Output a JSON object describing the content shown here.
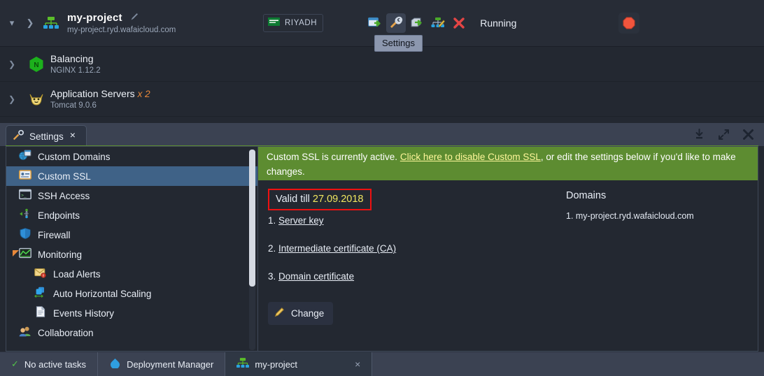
{
  "env_header": {
    "collapse_icon": "chevron-down",
    "expand_icon": "chevron-right",
    "env_icon": "environment-topology-icon",
    "name": "my-project",
    "edit_icon": "pencil-icon",
    "domain": "my-project.ryd.wafaicloud.com",
    "region": {
      "label": "RIYADH",
      "flag_icon": "saudi-flag-icon"
    },
    "tools": [
      {
        "name": "open-in-browser-icon",
        "title": "Open in Browser",
        "active": false
      },
      {
        "name": "settings-icon",
        "title": "Settings",
        "active": true
      },
      {
        "name": "clone-environment-icon",
        "title": "Clone Environment",
        "active": false
      },
      {
        "name": "change-topology-icon",
        "title": "Change Environment Topology",
        "active": false
      },
      {
        "name": "delete-icon",
        "title": "Delete Environment",
        "active": false
      }
    ],
    "status": "Running",
    "stop_icon": "stop-octagon-icon",
    "tooltip": "Settings"
  },
  "nodes": [
    {
      "chevron": "chevron-right",
      "icon": "nginx-icon",
      "title": "Balancing",
      "count": "",
      "subtitle": "NGINX 1.12.2"
    },
    {
      "chevron": "chevron-right",
      "icon": "tomcat-icon",
      "title": "Application Servers",
      "count": "x 2",
      "subtitle": "Tomcat 9.0.6"
    }
  ],
  "window": {
    "tab": {
      "icon": "settings-icon",
      "label": "Settings",
      "close": "×"
    },
    "actions": [
      {
        "name": "download-icon",
        "title": "Download"
      },
      {
        "name": "maximize-icon",
        "title": "Maximize"
      },
      {
        "name": "close-icon",
        "title": "Close"
      }
    ]
  },
  "sidebar": {
    "items": [
      {
        "label": "Custom Domains",
        "icon": "custom-domains-icon",
        "selected": false,
        "sub": false,
        "toggle": ""
      },
      {
        "label": "Custom SSL",
        "icon": "custom-ssl-icon",
        "selected": true,
        "sub": false,
        "toggle": ""
      },
      {
        "label": "SSH Access",
        "icon": "ssh-access-icon",
        "selected": false,
        "sub": false,
        "toggle": ""
      },
      {
        "label": "Endpoints",
        "icon": "endpoints-icon",
        "selected": false,
        "sub": false,
        "toggle": ""
      },
      {
        "label": "Firewall",
        "icon": "firewall-shield-icon",
        "selected": false,
        "sub": false,
        "toggle": ""
      },
      {
        "label": "Monitoring",
        "icon": "monitoring-chart-icon",
        "selected": false,
        "sub": false,
        "toggle": "expanded"
      },
      {
        "label": "Load Alerts",
        "icon": "load-alerts-envelope-icon",
        "selected": false,
        "sub": true,
        "toggle": ""
      },
      {
        "label": "Auto Horizontal Scaling",
        "icon": "auto-horizontal-scaling-icon",
        "selected": false,
        "sub": true,
        "toggle": ""
      },
      {
        "label": "Events History",
        "icon": "events-history-document-icon",
        "selected": false,
        "sub": true,
        "toggle": ""
      },
      {
        "label": "Collaboration",
        "icon": "collaboration-users-icon",
        "selected": false,
        "sub": false,
        "toggle": ""
      }
    ]
  },
  "content": {
    "banner": {
      "prefix": "Custom SSL is currently active. ",
      "link": "Click here to disable Custom SSL",
      "suffix": ", or edit the settings below if you'd like to make changes."
    },
    "valid_label": "Valid till ",
    "valid_date": "27.09.2018",
    "certs": [
      {
        "num": "1.",
        "label": "Server key"
      },
      {
        "num": "2.",
        "label": "Intermediate certificate (CA)"
      },
      {
        "num": "3.",
        "label": "Domain certificate"
      }
    ],
    "change_button": {
      "icon": "pencil-icon",
      "label": "Change"
    },
    "domains_title": "Domains",
    "domains": [
      "1. my-project.ryd.wafaicloud.com"
    ]
  },
  "statusbar": {
    "tasks": {
      "icon": "check-icon",
      "label": "No active tasks"
    },
    "deployment_manager": {
      "icon": "deployment-manager-icon",
      "label": "Deployment Manager"
    },
    "project_tab": {
      "icon": "environment-topology-icon",
      "label": "my-project",
      "close": "×"
    }
  },
  "colors": {
    "background": "#232831",
    "header": "#272c36",
    "tabbar": "#3b4252",
    "selection": "#3f6287",
    "banner_green": "#5d8c31",
    "banner_link": "#fff79a",
    "accent_orange": "#e8883a",
    "valid_date_yellow": "#efe55f",
    "highlight_red": "#ee1111",
    "status_green": "#53c24a"
  }
}
